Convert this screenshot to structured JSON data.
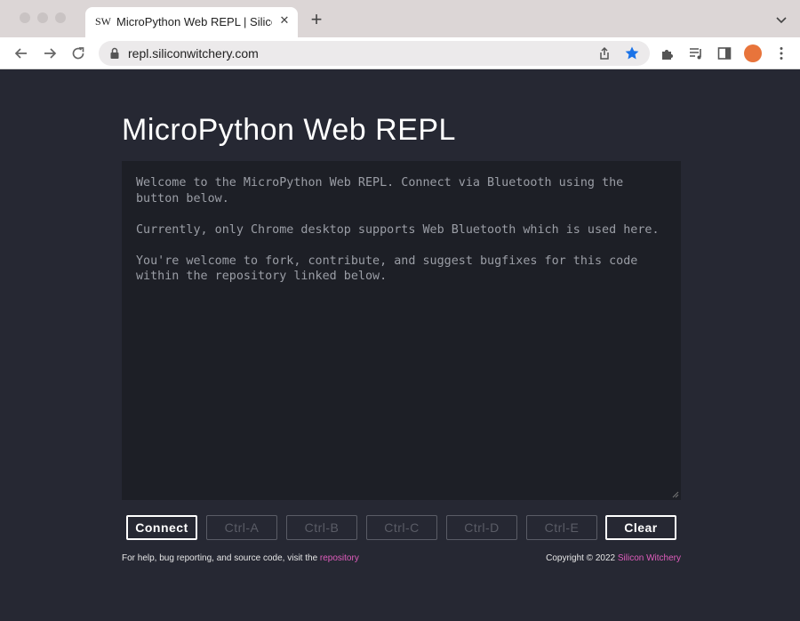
{
  "browser": {
    "tab": {
      "favicon_text": "SW",
      "title": "MicroPython Web REPL | Silicon Witchery",
      "close_icon": "close-icon"
    },
    "newtab_icon": "plus-icon",
    "address": "repl.siliconwitchery.com",
    "icons": [
      "back-icon",
      "forward-icon",
      "reload-icon",
      "lock-icon",
      "share-icon",
      "star-icon",
      "extensions-icon",
      "media-icon",
      "side-panel-icon",
      "avatar",
      "menu-icon"
    ]
  },
  "page": {
    "title": "MicroPython Web REPL",
    "terminal": {
      "paragraphs": [
        "Welcome to the MicroPython Web REPL. Connect via Bluetooth using the\nbutton below.",
        "Currently, only Chrome desktop supports Web Bluetooth which is used here.",
        "You're welcome to fork, contribute, and suggest bugfixes for this code\nwithin the repository linked below."
      ]
    },
    "buttons": {
      "connect": "Connect",
      "ctrl_a": "Ctrl-A",
      "ctrl_b": "Ctrl-B",
      "ctrl_c": "Ctrl-C",
      "ctrl_d": "Ctrl-D",
      "ctrl_e": "Ctrl-E",
      "clear": "Clear"
    },
    "footer": {
      "left_text": "For help, bug reporting, and source code, visit the ",
      "left_link": "repository",
      "right_text": "Copyright © 2022 ",
      "right_link": "Silicon Witchery"
    }
  },
  "colors": {
    "page_bg": "#262833",
    "terminal_bg": "#1d1f26",
    "link": "#e05dbd",
    "star": "#1a73e8"
  }
}
